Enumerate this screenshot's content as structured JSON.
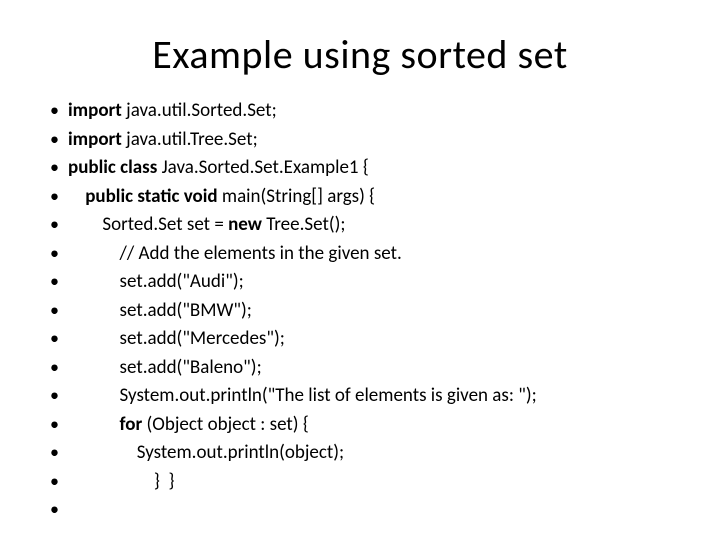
{
  "title": "Example using sorted set",
  "lines": [
    {
      "indent": 0,
      "segments": [
        {
          "t": "import ",
          "b": true
        },
        {
          "t": "java.util.Sorted.Set;",
          "b": false
        }
      ]
    },
    {
      "indent": 0,
      "segments": [
        {
          "t": "import ",
          "b": true
        },
        {
          "t": "java.util.Tree.Set;",
          "b": false
        }
      ]
    },
    {
      "indent": 0,
      "segments": [
        {
          "t": "public class ",
          "b": true
        },
        {
          "t": "Java.Sorted.Set.Example1 {",
          "b": false
        }
      ]
    },
    {
      "indent": 1,
      "segments": [
        {
          "t": "public static void ",
          "b": true
        },
        {
          "t": "main(String[] args) {",
          "b": false
        }
      ]
    },
    {
      "indent": 2,
      "segments": [
        {
          "t": "Sorted.Set set = ",
          "b": false
        },
        {
          "t": "new ",
          "b": true
        },
        {
          "t": "Tree.Set();",
          "b": false
        }
      ]
    },
    {
      "indent": 3,
      "segments": [
        {
          "t": "// Add the elements in the given set.",
          "b": false
        }
      ]
    },
    {
      "indent": 3,
      "segments": [
        {
          "t": "set.add(\"Audi\");",
          "b": false
        }
      ]
    },
    {
      "indent": 3,
      "segments": [
        {
          "t": "set.add(\"BMW\");",
          "b": false
        }
      ]
    },
    {
      "indent": 3,
      "segments": [
        {
          "t": "set.add(\"Mercedes\");",
          "b": false
        }
      ]
    },
    {
      "indent": 3,
      "segments": [
        {
          "t": "set.add(\"Baleno\");",
          "b": false
        }
      ]
    },
    {
      "indent": 3,
      "segments": [
        {
          "t": "System.out.println(\"The list of elements is given as: \");",
          "b": false
        }
      ]
    },
    {
      "indent": 3,
      "segments": [
        {
          "t": "for ",
          "b": true
        },
        {
          "t": "(Object object : set) {",
          "b": false
        }
      ]
    },
    {
      "indent": 4,
      "segments": [
        {
          "t": "System.out.println(object);",
          "b": false
        }
      ]
    },
    {
      "indent": 5,
      "segments": [
        {
          "t": "}  }",
          "b": false
        }
      ]
    },
    {
      "indent": 0,
      "segments": [
        {
          "t": "",
          "b": false
        }
      ]
    }
  ],
  "indent_unit": "    "
}
